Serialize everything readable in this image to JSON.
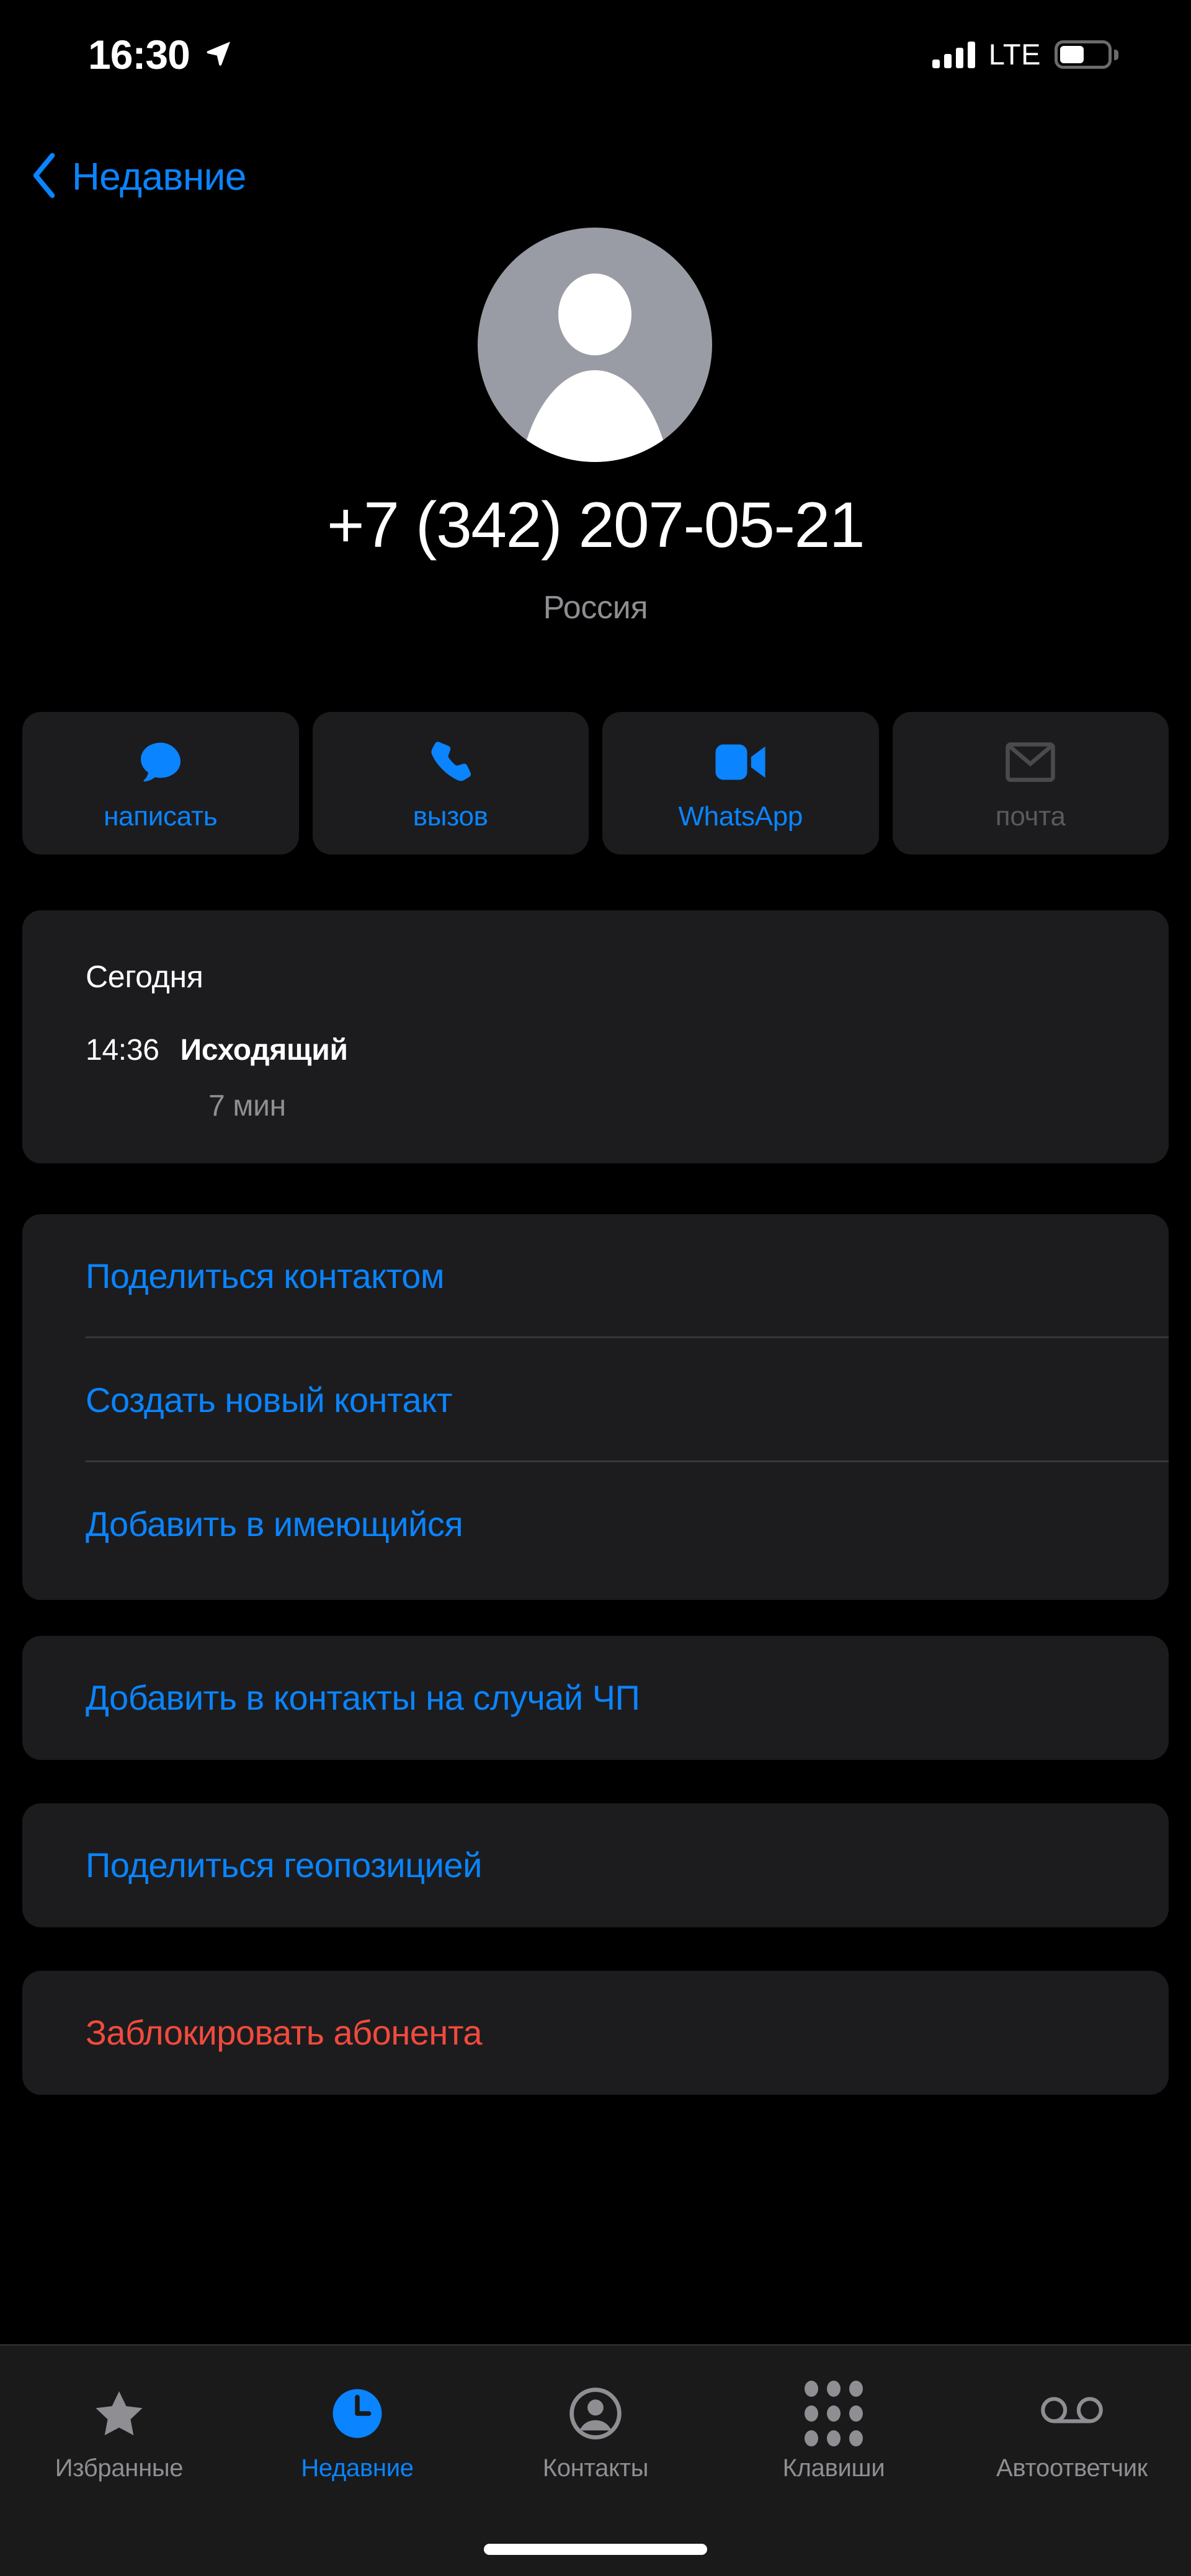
{
  "status_bar": {
    "time": "16:30",
    "carrier_network": "LTE",
    "location_icon": "location-arrow-icon",
    "signal_bars": 4,
    "battery_percent": 45
  },
  "nav": {
    "back_label": "Недавние",
    "back_icon": "chevron-left-icon"
  },
  "contact": {
    "avatar_icon": "person-placeholder-avatar",
    "phone_number": "+7 (342) 207-05-21",
    "country": "Россия"
  },
  "actions": [
    {
      "label": "написать",
      "icon": "message-bubble-icon",
      "enabled": true
    },
    {
      "label": "вызов",
      "icon": "phone-handset-icon",
      "enabled": true
    },
    {
      "label": "WhatsApp",
      "icon": "video-camera-icon",
      "enabled": true
    },
    {
      "label": "почта",
      "icon": "envelope-icon",
      "enabled": false
    }
  ],
  "call_history": {
    "day": "Сегодня",
    "time": "14:36",
    "type": "Исходящий",
    "duration": "7 мин"
  },
  "list": {
    "group_one": [
      "Поделиться контактом",
      "Создать новый контакт",
      "Добавить в имеющийся"
    ],
    "sos": "Добавить в контакты на случай ЧП",
    "geo": "Поделиться геопозицией",
    "block": "Заблокировать абонента"
  },
  "tabbar": [
    {
      "label": "Избранные",
      "icon": "star-icon",
      "active": false
    },
    {
      "label": "Недавние",
      "icon": "clock-icon",
      "active": true
    },
    {
      "label": "Контакты",
      "icon": "person-circle-icon",
      "active": false
    },
    {
      "label": "Клавиши",
      "icon": "keypad-dots-icon",
      "active": false
    },
    {
      "label": "Автоответчик",
      "icon": "voicemail-icon",
      "active": false
    }
  ],
  "colors": {
    "accent_blue": "#0A84FF",
    "danger_red": "#F24A3D",
    "card_bg": "#1C1C1E",
    "secondary_text": "#8E8E93",
    "avatar_gray": "#9A9CA5"
  }
}
